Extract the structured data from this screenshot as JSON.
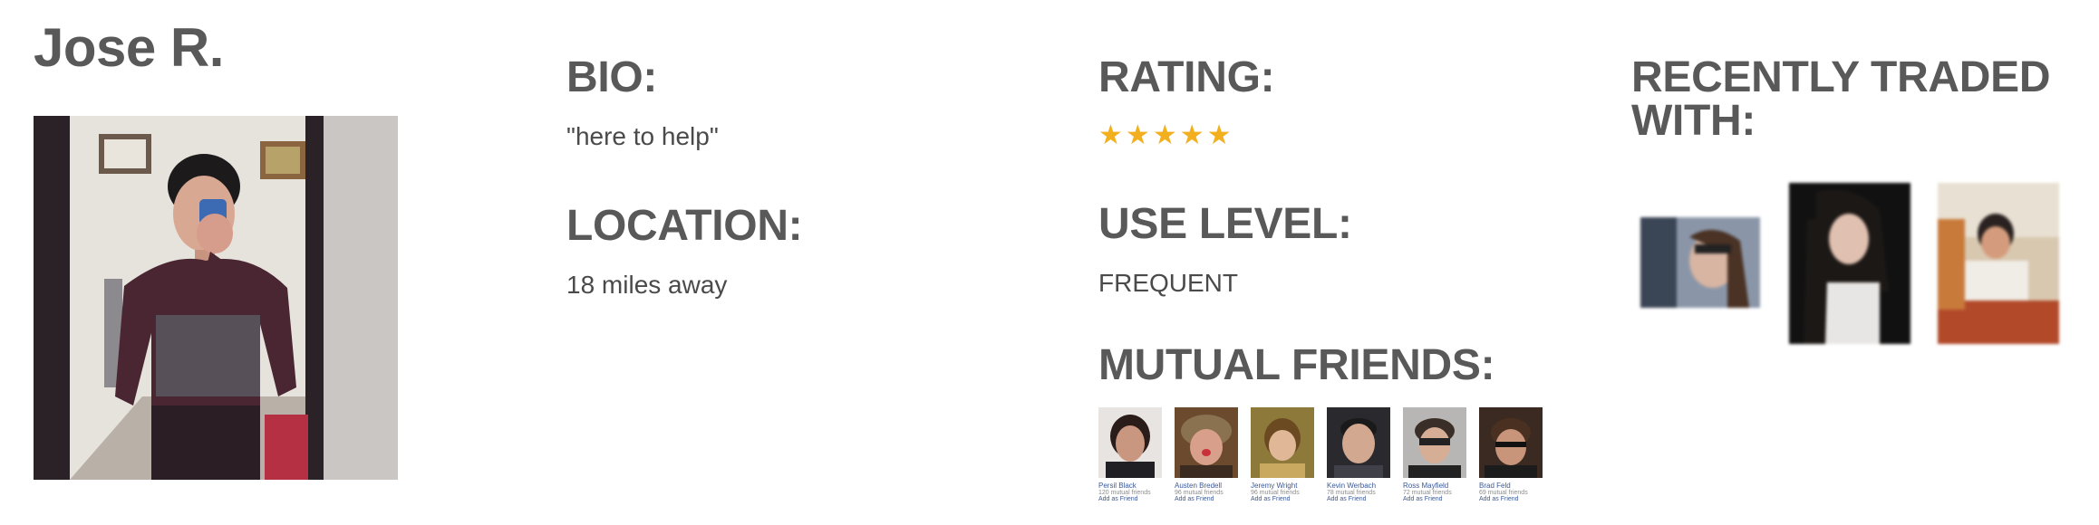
{
  "profile": {
    "name": "Jose R."
  },
  "bio": {
    "heading": "BIO:",
    "text": "\"here to help\""
  },
  "location": {
    "heading": "LOCATION:",
    "text": "18 miles away"
  },
  "rating": {
    "heading": "RATING:",
    "stars": 5,
    "max_stars": 5,
    "star_color": "#f2b01e"
  },
  "use_level": {
    "heading": "USE LEVEL:",
    "text": "FREQUENT"
  },
  "mutual_friends": {
    "heading": "MUTUAL FRIENDS:",
    "friends": [
      {
        "name": "Persil Black",
        "mutual": "120 mutual friends",
        "action": "Add as Friend"
      },
      {
        "name": "Austen Bredell",
        "mutual": "96 mutual friends",
        "action": "Add as Friend"
      },
      {
        "name": "Jeremy Wright",
        "mutual": "96 mutual friends",
        "action": "Add as Friend"
      },
      {
        "name": "Kevin Werbach",
        "mutual": "78 mutual friends",
        "action": "Add as Friend"
      },
      {
        "name": "Ross Mayfield",
        "mutual": "72 mutual friends",
        "action": "Add as Friend"
      },
      {
        "name": "Brad Feld",
        "mutual": "69 mutual friends",
        "action": "Add as Friend"
      }
    ]
  },
  "recently_traded": {
    "heading": "RECENTLY TRADED WITH:"
  },
  "colors": {
    "text": "#595959",
    "star": "#f2b01e",
    "link": "#3b5998"
  }
}
